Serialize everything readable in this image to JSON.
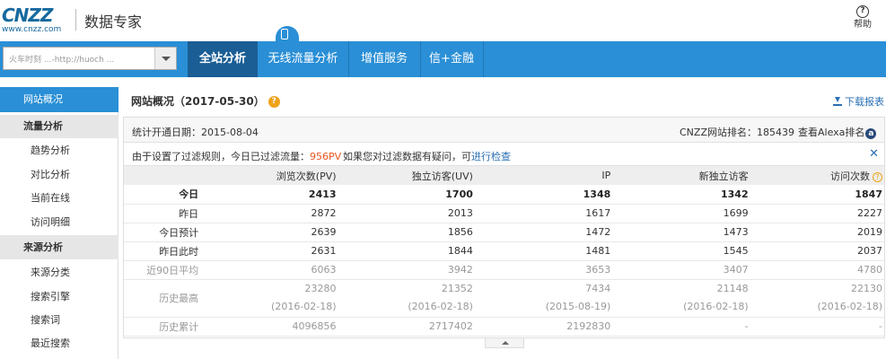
{
  "header": {
    "logo_text": "CNZZ",
    "logo_url": "www.cnzz.com",
    "brand_title": "数据专家",
    "help_label": "帮助"
  },
  "nav": {
    "site_select_value": "火车时刻 ...-http://huoch ...",
    "tabs": [
      {
        "label": "全站分析",
        "active": true
      },
      {
        "label": "无线流量分析",
        "active": false
      },
      {
        "label": "增值服务",
        "active": false
      },
      {
        "label": "信+金融",
        "active": false
      }
    ]
  },
  "sidebar": {
    "items": [
      {
        "label": "网站概况",
        "type": "active"
      },
      {
        "label": "流量分析",
        "type": "group"
      },
      {
        "label": "趋势分析",
        "type": "sub"
      },
      {
        "label": "对比分析",
        "type": "sub"
      },
      {
        "label": "当前在线",
        "type": "sub"
      },
      {
        "label": "访问明细",
        "type": "sub"
      },
      {
        "label": "来源分析",
        "type": "group"
      },
      {
        "label": "来源分类",
        "type": "sub"
      },
      {
        "label": "搜索引擎",
        "type": "sub"
      },
      {
        "label": "搜索词",
        "type": "sub"
      },
      {
        "label": "最近搜索",
        "type": "sub"
      }
    ]
  },
  "main": {
    "title": "网站概况（2017-05-30）",
    "download_label": "下载报表",
    "stats": {
      "open_date": "统计开通日期：2015-08-04",
      "rank": "CNZZ网站排名：185439",
      "alexa": "查看Alexa排名"
    },
    "notice": {
      "prefix": "由于设置了过滤规则，今日已过滤流量：",
      "count": "956PV",
      "question": "如果您对过滤数据有疑问，可",
      "link": "进行检查"
    },
    "table": {
      "headers": [
        "",
        "浏览次数(PV)",
        "独立访客(UV)",
        "IP",
        "新独立访客",
        "访问次数"
      ],
      "rows": [
        {
          "label": "今日",
          "values": [
            "2413",
            "1700",
            "1348",
            "1342",
            "1847"
          ]
        },
        {
          "label": "昨日",
          "values": [
            "2872",
            "2013",
            "1617",
            "1699",
            "2227"
          ]
        },
        {
          "label": "今日预计",
          "values": [
            "2639",
            "1856",
            "1472",
            "1473",
            "2019"
          ]
        },
        {
          "label": "昨日此时",
          "values": [
            "2631",
            "1844",
            "1481",
            "1545",
            "2037"
          ]
        },
        {
          "label": "近90日平均",
          "values": [
            "6063",
            "3942",
            "3653",
            "3407",
            "4780"
          ]
        },
        {
          "label": "历史最高",
          "values": [
            "23280",
            "21352",
            "7434",
            "21148",
            "22130"
          ],
          "dates": [
            "(2016-02-18)",
            "(2016-02-18)",
            "(2015-08-19)",
            "(2016-02-18)",
            "(2016-02-18)"
          ]
        },
        {
          "label": "历史累计",
          "values": [
            "4096856",
            "2717402",
            "2192830",
            "-",
            "-"
          ]
        }
      ]
    }
  }
}
